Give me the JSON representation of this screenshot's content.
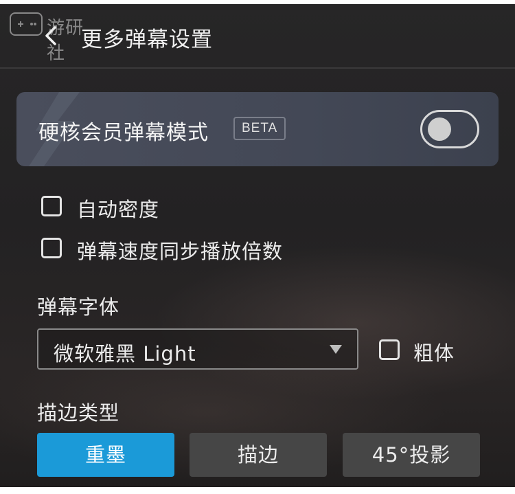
{
  "watermark": {
    "text": "游研社"
  },
  "header": {
    "title": "更多弹幕设置",
    "back_icon": "chevron-left-icon"
  },
  "hardcore": {
    "title": "硬核会员弹幕模式",
    "badge": "BETA",
    "toggle_on": false
  },
  "options": [
    {
      "label": "自动密度",
      "checked": false
    },
    {
      "label": "弹幕速度同步播放倍数",
      "checked": false
    }
  ],
  "font": {
    "section_label": "弹幕字体",
    "selected": "微软雅黑 Light",
    "bold_label": "粗体",
    "bold_checked": false
  },
  "stroke": {
    "section_label": "描边类型",
    "options": [
      "重墨",
      "描边",
      "45°投影"
    ],
    "selected_index": 0
  },
  "colors": {
    "accent": "#1b9ad8",
    "card": "#474b58",
    "background": "#242324"
  }
}
